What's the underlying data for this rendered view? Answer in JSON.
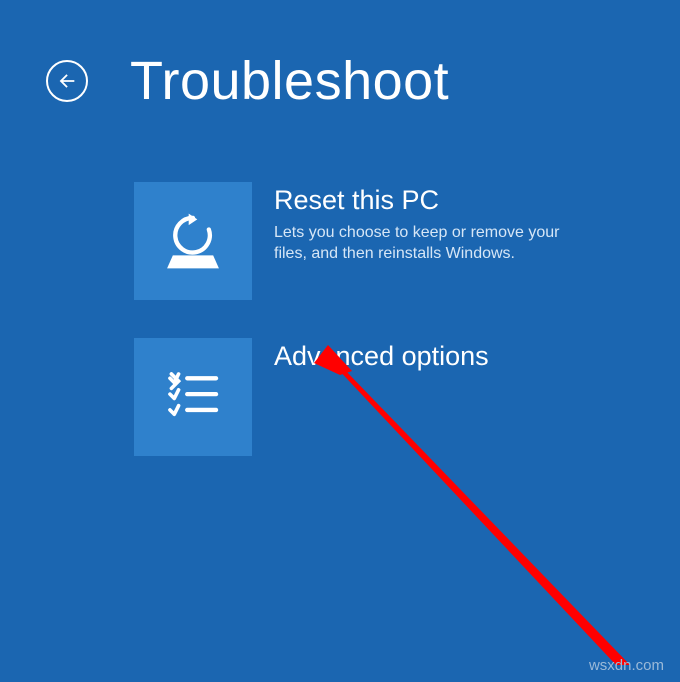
{
  "header": {
    "title": "Troubleshoot"
  },
  "options": [
    {
      "title": "Reset this PC",
      "description": "Lets you choose to keep or remove your files, and then reinstalls Windows."
    },
    {
      "title": "Advanced options",
      "description": ""
    }
  ],
  "watermark": "wsxdn.com"
}
